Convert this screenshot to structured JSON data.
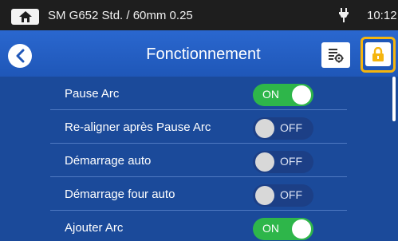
{
  "statusbar": {
    "home_icon": "home-icon",
    "profile": "SM G652 Std. / 60mm 0.25",
    "power_icon": "plug-icon",
    "time": "10:12"
  },
  "header": {
    "back_icon": "chevron-left-icon",
    "title": "Fonctionnement",
    "settings_icon": "list-settings-icon",
    "lock_icon": "lock-icon",
    "lock_highlight_color": "#f5b50e"
  },
  "settings": [
    {
      "label": "Pause Arc",
      "state": "ON"
    },
    {
      "label": "Re-aligner après Pause Arc",
      "state": "OFF"
    },
    {
      "label": "Démarrage auto",
      "state": "OFF"
    },
    {
      "label": "Démarrage four auto",
      "state": "OFF"
    },
    {
      "label": "Ajouter Arc",
      "state": "ON"
    }
  ],
  "colors": {
    "on": "#2eb64a",
    "off": "#1c3f86",
    "background": "#1b4a9a"
  }
}
